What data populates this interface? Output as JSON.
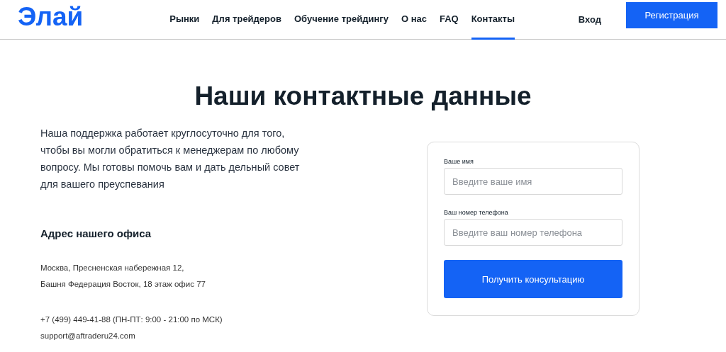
{
  "header": {
    "logo": "Элай",
    "nav": [
      {
        "label": "Рынки",
        "selected": false
      },
      {
        "label": "Для трейдеров",
        "selected": false
      },
      {
        "label": "Обучение трейдингу",
        "selected": false
      },
      {
        "label": "О нас",
        "selected": false
      },
      {
        "label": "FAQ",
        "selected": false
      },
      {
        "label": "Контакты",
        "selected": true
      }
    ],
    "login": "Вход",
    "register": "Регистрация"
  },
  "heading": "Наши контактные данные",
  "intro": "Наша поддержка работает круглосуточно для того, чтобы вы могли обратиться к менеджерам по любому вопросу. Мы готовы помочь вам и дать дельный совет для вашего преуспевания",
  "address_heading": "Адрес нашего офиса",
  "address_lines": [
    "Москва, Пресненская набережная 12,",
    "Башня Федерация Восток, 18 этаж офис 77"
  ],
  "phone": "+7 (499) 449-41-88 (ПН-ПТ: 9:00 - 21:00 по МСК)",
  "email": "support@aftraderu24.com",
  "form": {
    "fields": [
      {
        "label": "Ваше имя",
        "placeholder": "Введите ваше имя"
      },
      {
        "label": "Ваш номер телефона",
        "placeholder": "Введите ваш номер телефона"
      }
    ],
    "submit": "Получить консультацию"
  }
}
